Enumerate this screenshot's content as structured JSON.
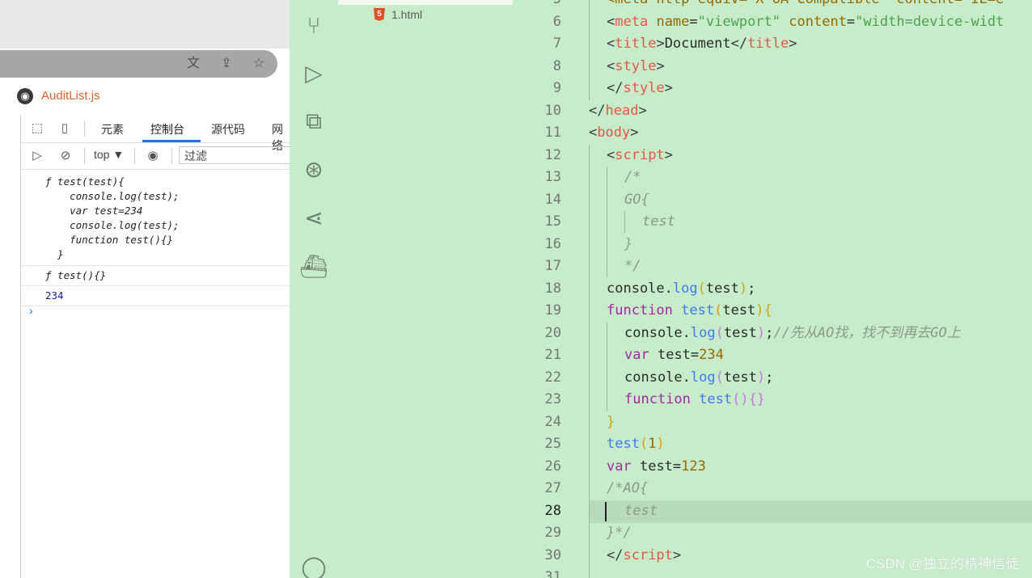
{
  "browser": {
    "tab_title": "AuditList.js",
    "addr_icons": [
      "translate-icon",
      "share-icon",
      "star-icon"
    ]
  },
  "devtools": {
    "tabs": [
      "元素",
      "控制台",
      "源代码",
      "网络"
    ],
    "active_tab": "控制台",
    "context": "top",
    "filter_placeholder": "过滤",
    "console": {
      "entry1": [
        "ƒ test(test){",
        "    console.log(test);",
        "    var test=234",
        "    console.log(test);",
        "    function test(){}",
        "  }"
      ],
      "entry2": "ƒ test(){}",
      "entry3": "234",
      "prompt": "›"
    }
  },
  "editor": {
    "file_name": "1.html",
    "line_numbers": [
      "5",
      "6",
      "7",
      "8",
      "9",
      "10",
      "11",
      "12",
      "13",
      "14",
      "15",
      "16",
      "17",
      "18",
      "19",
      "20",
      "21",
      "22",
      "23",
      "24",
      "25",
      "26",
      "27",
      "28",
      "29",
      "30",
      "31"
    ],
    "current_line": "28",
    "code": {
      "l5a": "<meta http-equiv=\"X-UA-Compatible\" content=\"IE=e",
      "l6_tag": "meta",
      "l6_attr1": "name",
      "l6_val1": "\"viewport\"",
      "l6_attr2": "content",
      "l6_val2": "\"width=device-widt",
      "l7_tag": "title",
      "l7_text": "Document",
      "l8_tag": "style",
      "l9_tag": "style",
      "l10_tag": "head",
      "l11_tag": "body",
      "l12_tag": "script",
      "l13": "/*",
      "l14": "GO{",
      "l15": "test",
      "l16": "}",
      "l17": "*/",
      "l18_obj": "console",
      "l18_fn": "log",
      "l18_arg": "test",
      "l19_kw": "function",
      "l19_fn": "test",
      "l19_arg": "test",
      "l20_obj": "console",
      "l20_fn": "log",
      "l20_arg": "test",
      "l20_cmt": "//先从AO找，找不到再去GO上",
      "l21_kw": "var",
      "l21_var": "test",
      "l21_num": "234",
      "l22_obj": "console",
      "l22_fn": "log",
      "l22_arg": "test",
      "l23_kw": "function",
      "l23_fn": "test",
      "l23_rest": "(){}",
      "l24": "}",
      "l25_fn": "test",
      "l25_num": "1",
      "l26_kw": "var",
      "l26_var": "test",
      "l26_num": "123",
      "l27": "/*AO{",
      "l28": "test",
      "l29": "}*/",
      "l30_tag": "script"
    }
  },
  "watermark": "CSDN @独立的精神信徒",
  "colors": {
    "editor_bg": "#c7ecca",
    "accent": "#1a73e8",
    "tab_title": "#d9622b"
  }
}
